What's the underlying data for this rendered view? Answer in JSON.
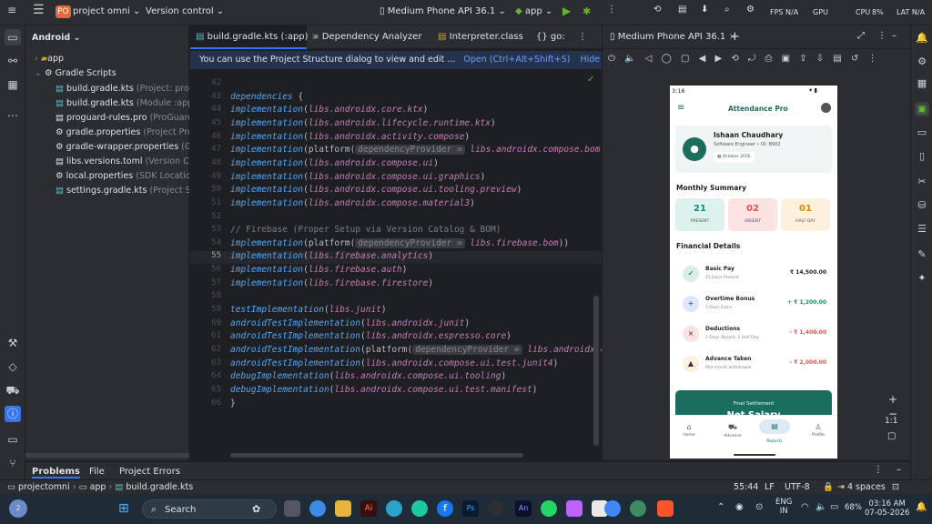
{
  "topbar": {
    "project_badge": "PO",
    "project_name": "project omni",
    "vcs": "Version control",
    "device": "Medium Phone API 36.1",
    "run_config": "app",
    "fps": "FPS N/A",
    "gpu": "GPU",
    "cpu": "CPU",
    "cpu_val": "8%",
    "lat": "LAT N/A"
  },
  "project_panel": {
    "view": "Android",
    "items": [
      {
        "label": "app",
        "detail": ""
      },
      {
        "label": "Gradle Scripts",
        "detail": ""
      },
      {
        "label": "build.gradle.kts",
        "detail": "(Project: project_"
      },
      {
        "label": "build.gradle.kts",
        "detail": "(Module :app)"
      },
      {
        "label": "proguard-rules.pro",
        "detail": "(ProGuard Ru"
      },
      {
        "label": "gradle.properties",
        "detail": "(Project Prope"
      },
      {
        "label": "gradle-wrapper.properties",
        "detail": "(Grad"
      },
      {
        "label": "libs.versions.toml",
        "detail": "(Version Catal"
      },
      {
        "label": "local.properties",
        "detail": "(SDK Location)"
      },
      {
        "label": "settings.gradle.kts",
        "detail": "(Project Setti"
      }
    ]
  },
  "tabs": [
    "build.gradle.kts (:app)",
    "Dependency Analyzer",
    "Interpreter.class",
    "go:"
  ],
  "notice": {
    "text": "You can use the Project Structure dialog to view and edit ...",
    "open": "Open (Ctrl+Alt+Shift+S)",
    "hide": "Hide notification"
  },
  "editor": {
    "lines": [
      {
        "n": "42",
        "code": ""
      },
      {
        "n": "43",
        "code": "dependencies {"
      },
      {
        "n": "44",
        "code": "    implementation(libs.androidx.core.ktx)"
      },
      {
        "n": "45",
        "code": "    implementation(libs.androidx.lifecycle.runtime.ktx)"
      },
      {
        "n": "46",
        "code": "    implementation(libs.androidx.activity.compose)"
      },
      {
        "n": "47",
        "code": "    implementation(platform( dependencyProvider = libs.androidx.compose.bom))"
      },
      {
        "n": "48",
        "code": "    implementation(libs.androidx.compose.ui)"
      },
      {
        "n": "49",
        "code": "    implementation(libs.androidx.compose.ui.graphics)"
      },
      {
        "n": "50",
        "code": "    implementation(libs.androidx.compose.ui.tooling.preview)"
      },
      {
        "n": "51",
        "code": "    implementation(libs.androidx.compose.material3)"
      },
      {
        "n": "52",
        "code": ""
      },
      {
        "n": "53",
        "code": "    // Firebase (Proper Setup via Version Catalog & BOM)"
      },
      {
        "n": "54",
        "code": "    implementation(platform( dependencyProvider = libs.firebase.bom))"
      },
      {
        "n": "55",
        "code": "    implementation(libs.firebase.analytics)"
      },
      {
        "n": "56",
        "code": "    implementation(libs.firebase.auth)"
      },
      {
        "n": "57",
        "code": "    implementation(libs.firebase.firestore)"
      },
      {
        "n": "58",
        "code": ""
      },
      {
        "n": "59",
        "code": "    testImplementation(libs.junit)"
      },
      {
        "n": "60",
        "code": "    androidTestImplementation(libs.androidx.junit)"
      },
      {
        "n": "61",
        "code": "    androidTestImplementation(libs.androidx.espresso.core)"
      },
      {
        "n": "62",
        "code": "    androidTestImplementation(platform( dependencyProvider = libs.androidx.comp"
      },
      {
        "n": "63",
        "code": "    androidTestImplementation(libs.androidx.compose.ui.test.junit4)"
      },
      {
        "n": "64",
        "code": "    debugImplementation(libs.androidx.compose.ui.tooling)"
      },
      {
        "n": "65",
        "code": "    debugImplementation(libs.androidx.compose.ui.test.manifest)"
      },
      {
        "n": "66",
        "code": "}"
      }
    ]
  },
  "device_panel": {
    "tab": "Medium Phone API 36.1",
    "zoom": "1:1"
  },
  "phone": {
    "time": "3:16",
    "app_title": "Attendance Pro",
    "user_name": "Ishaan Chaudhary",
    "user_role": "Software Engineer • ID: B902",
    "month": "October 2026",
    "monthly_title": "Monthly Summary",
    "summary": [
      {
        "value": "21",
        "label": "PRESENT",
        "color": "#1b8a78",
        "bg": "#ddf1ee"
      },
      {
        "value": "02",
        "label": "ABSENT",
        "color": "#d9534f",
        "bg": "#fbe3e2"
      },
      {
        "value": "01",
        "label": "HALF DAY",
        "color": "#e08a00",
        "bg": "#fdf0dc"
      }
    ],
    "fin_title": "Financial Details",
    "fin": [
      {
        "title": "Basic Pay",
        "sub": "21 Days Present",
        "amount": "₹ 14,500.00",
        "color": "#222222",
        "icon": "✓",
        "ibg": "#d9efe6"
      },
      {
        "title": "Overtime Bonus",
        "sub": "3 Days Extra",
        "amount": "+ ₹ 1,200.00",
        "color": "#1b8a58",
        "icon": "+",
        "ibg": "#dbe8fb"
      },
      {
        "title": "Deductions",
        "sub": "2 Days Absent, 1 Half Day",
        "amount": "- ₹ 1,400.00",
        "color": "#d9534f",
        "icon": "×",
        "ibg": "#fbe3e2"
      },
      {
        "title": "Advance Taken",
        "sub": "Mid-month withdrawal",
        "amount": "- ₹ 2,000.00",
        "color": "#d9534f",
        "icon": "▲",
        "ibg": "#fdf0dc"
      }
    ],
    "settlement_label": "Final Settlement",
    "net_label": "Net Salary",
    "nav": [
      "Home",
      "Advance",
      "Reports",
      "Profile"
    ]
  },
  "bottom_tabs": [
    "Problems",
    "File",
    "Project Errors"
  ],
  "breadcrumb": [
    "projectomni",
    "app",
    "build.gradle.kts"
  ],
  "status": {
    "pos": "55:44",
    "lf": "LF",
    "enc": "UTF-8",
    "indent": "4 spaces"
  },
  "taskbar": {
    "search": "Search",
    "lang1": "ENG",
    "lang2": "IN",
    "battery": "68%",
    "time": "03:16 AM",
    "date": "07-05-2026",
    "badge": "2"
  }
}
